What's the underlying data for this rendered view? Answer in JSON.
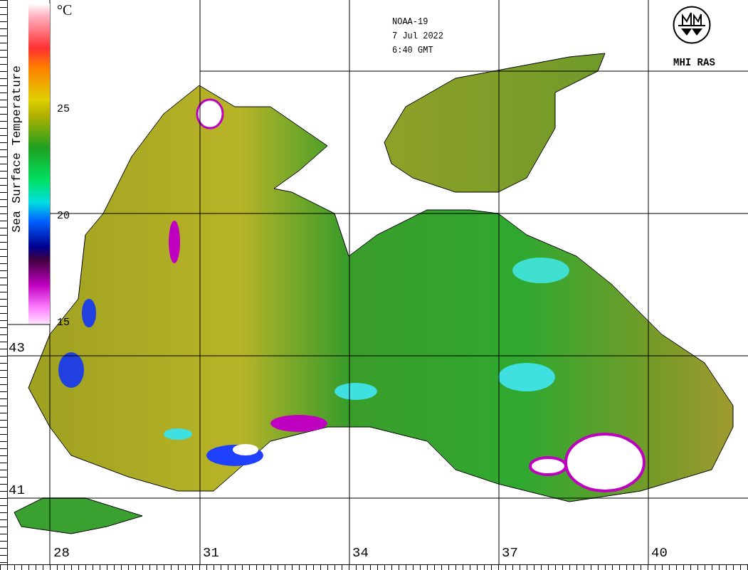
{
  "header": {
    "satellite": "NOAA-19",
    "date": "7 Jul 2022",
    "time": "6:40 GMT"
  },
  "logo": {
    "text": "MHI RAS"
  },
  "color_scale": {
    "title": "Sea Surface Temperature",
    "unit": "°C",
    "ticks": [
      "25",
      "20",
      "15"
    ]
  },
  "latitude_labels": [
    "43",
    "41"
  ],
  "longitude_labels": [
    "28",
    "31",
    "34",
    "37",
    "40"
  ]
}
